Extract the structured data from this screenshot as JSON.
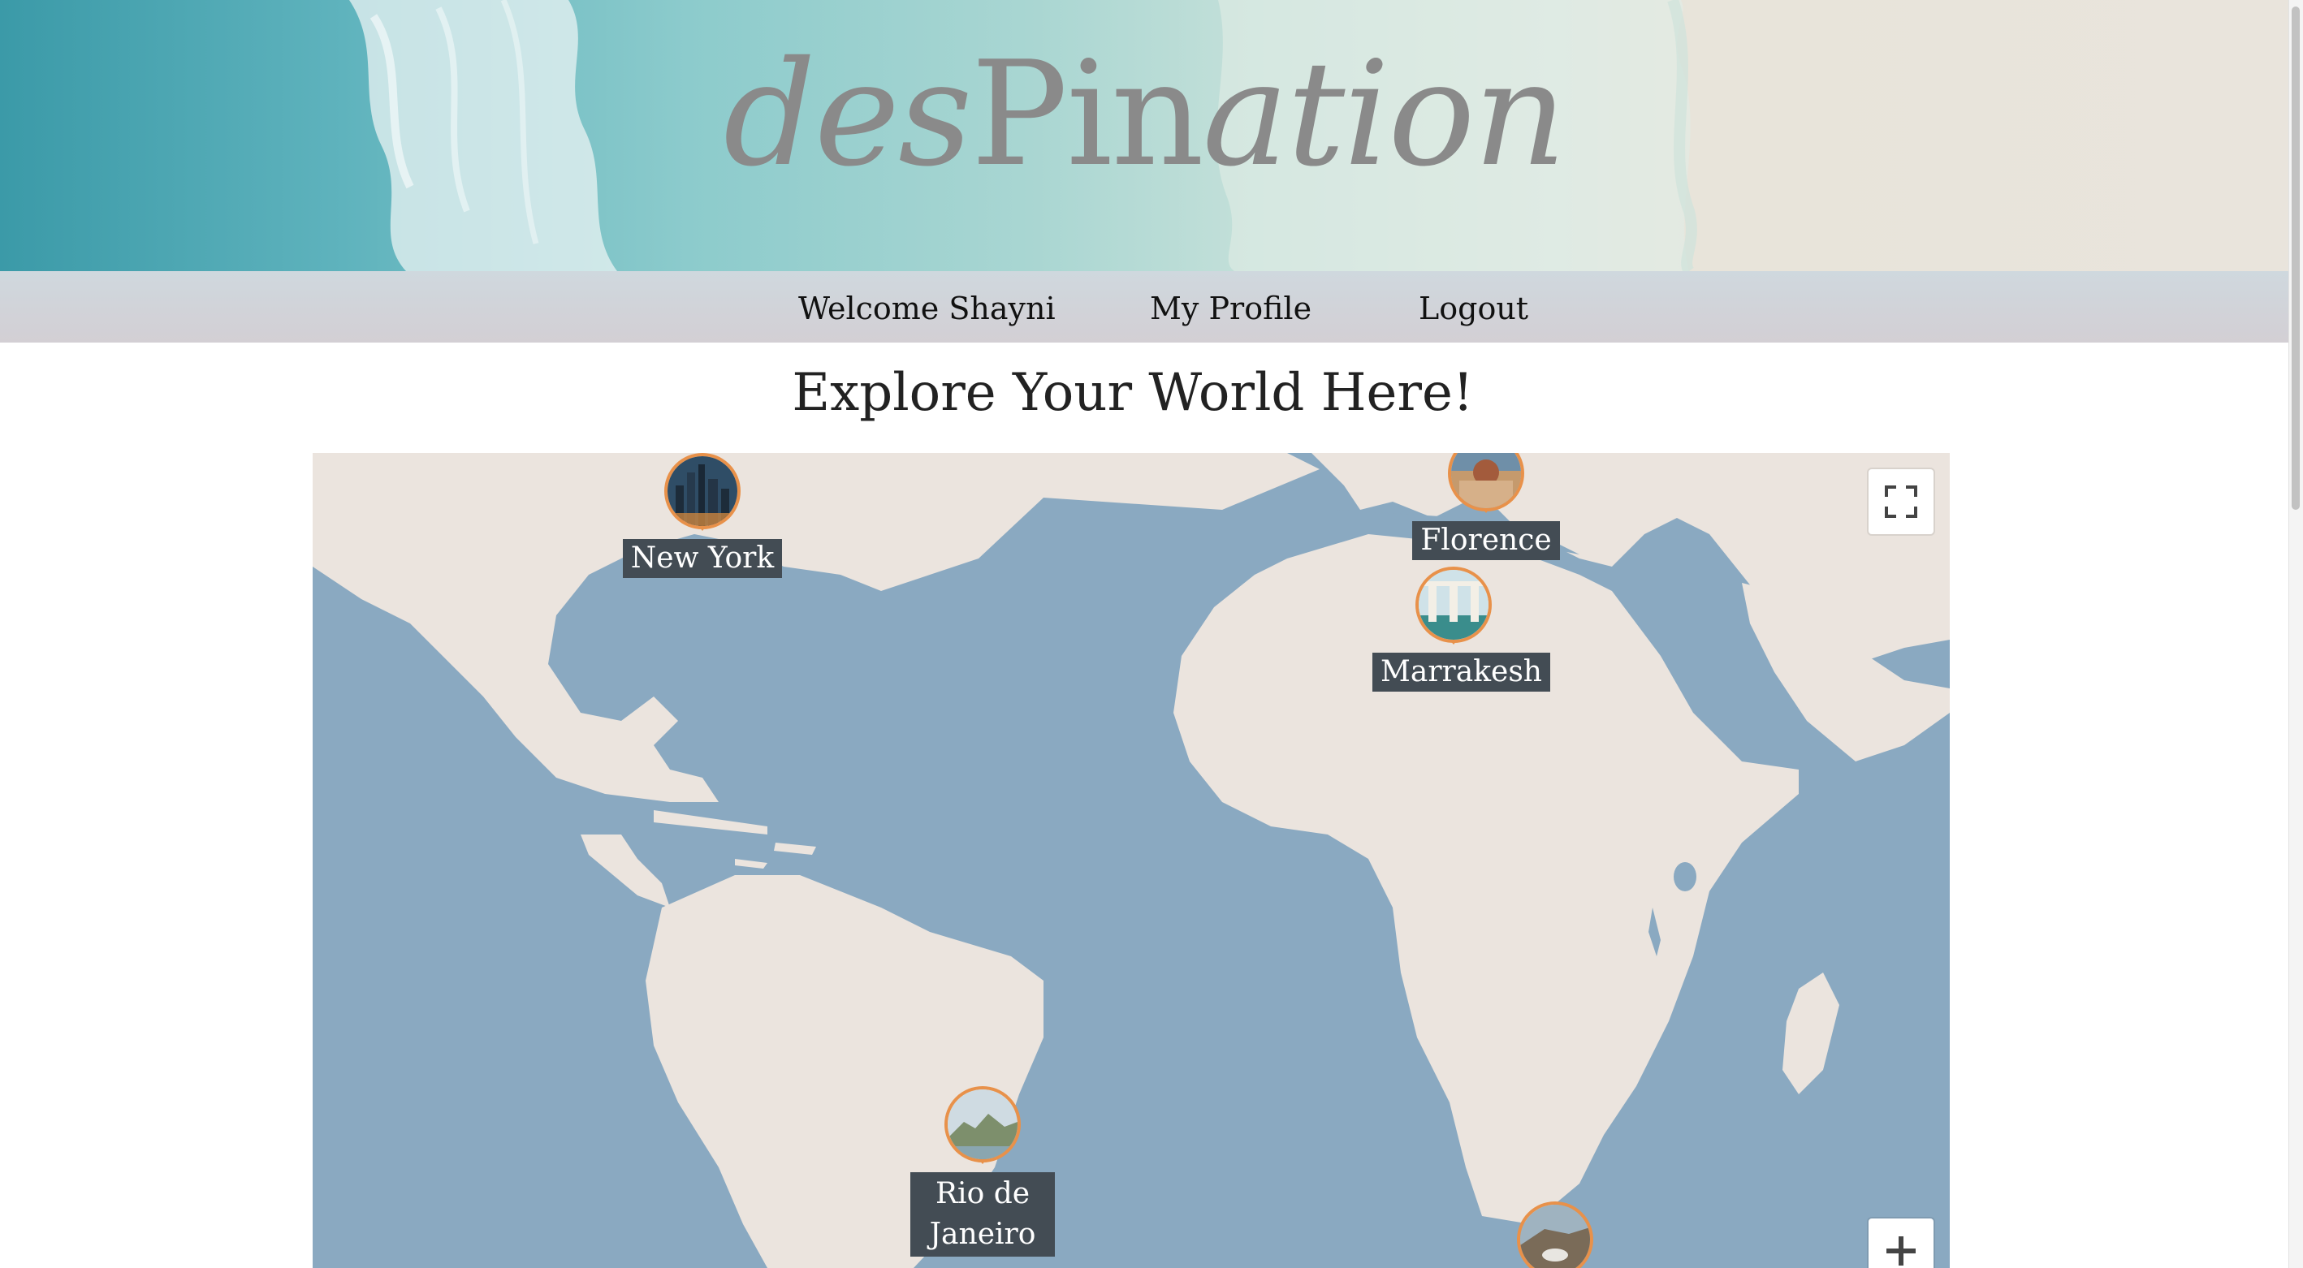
{
  "brand": {
    "logo_part1": "des",
    "logo_part2": "Pin",
    "logo_part3": "ation"
  },
  "nav": {
    "welcome": "Welcome Shayni",
    "profile": "My Profile",
    "logout": "Logout"
  },
  "main": {
    "title": "Explore Your World Here!"
  },
  "map": {
    "markers": [
      {
        "id": "new-york",
        "label": "New York"
      },
      {
        "id": "florence",
        "label": "Florence"
      },
      {
        "id": "marrakesh",
        "label": "Marrakesh"
      },
      {
        "id": "rio",
        "label": "Rio de Janeiro"
      },
      {
        "id": "cape-town",
        "label": ""
      }
    ],
    "controls": {
      "fullscreen_icon": "fullscreen-icon",
      "zoom_in_icon": "plus-icon"
    }
  },
  "colors": {
    "ocean": "#8aa9c1",
    "land": "#ebe4de",
    "marker_border": "#e8914a",
    "label_bg": "#434c54",
    "logo_text": "#8a8a8a"
  }
}
